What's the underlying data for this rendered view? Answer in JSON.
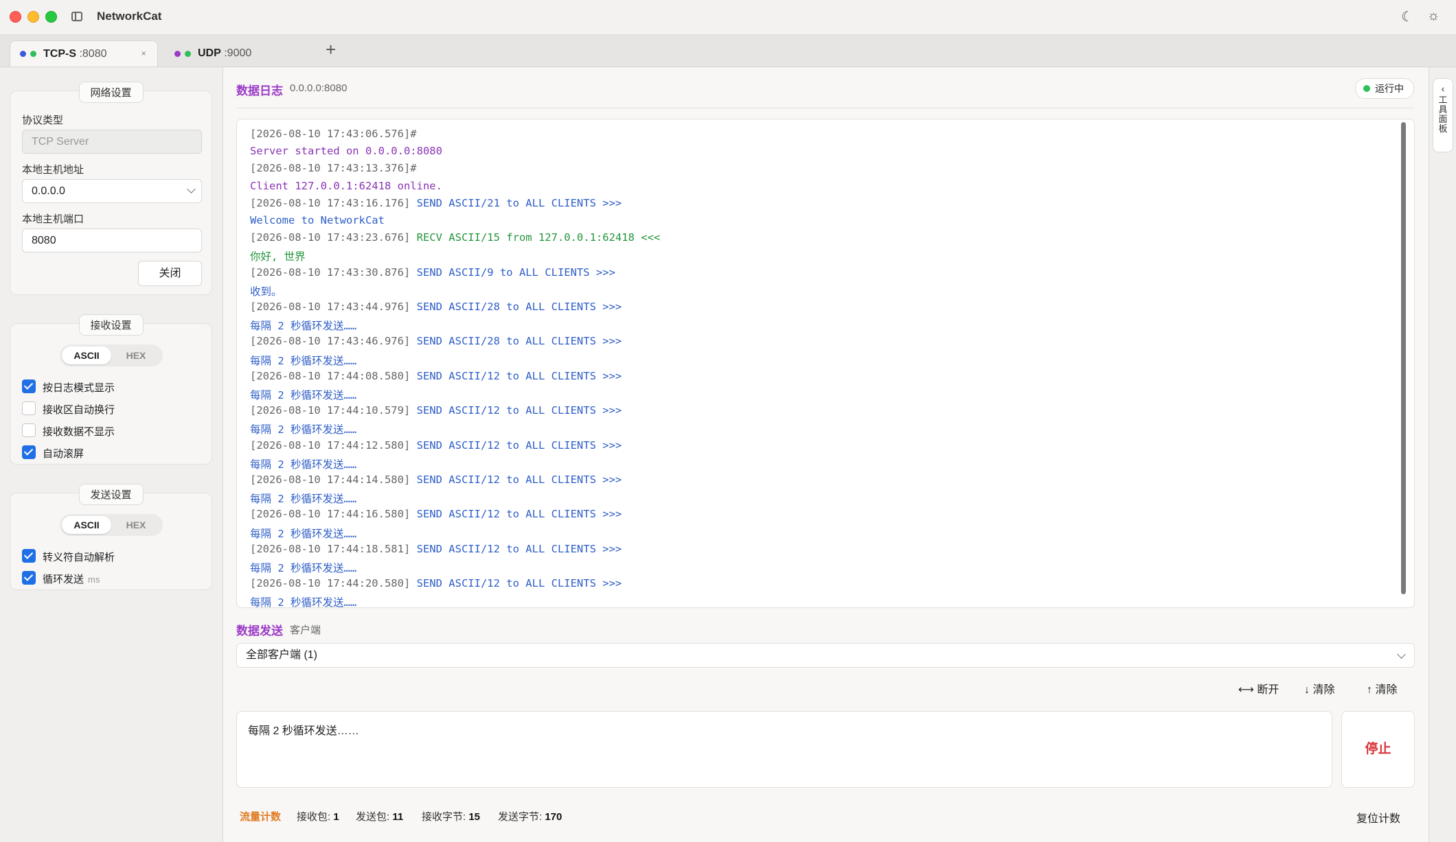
{
  "window": {
    "title": "NetworkCat",
    "theme_icon": "moon-icon",
    "settings_icon": "sun-icon"
  },
  "tabs": [
    {
      "name": "TCP-S",
      "port": ":8080",
      "close": "×",
      "dot_colors": [
        "#3b5bdb",
        "#2ec05a"
      ]
    },
    {
      "name": "UDP",
      "port": ":9000",
      "dot_colors": [
        "#9b3bc6",
        "#2ec05a"
      ]
    }
  ],
  "tab_add": "+",
  "network": {
    "title": "网络设置",
    "protocol_label": "协议类型",
    "protocol_value": "TCP Server",
    "host_label": "本地主机地址",
    "host_value": "0.0.0.0",
    "port_label": "本地主机端口",
    "port_value": "8080",
    "close_button": "关闭"
  },
  "receive": {
    "title": "接收设置",
    "modes": [
      "ASCII",
      "HEX"
    ],
    "selected_mode": "ASCII",
    "options": [
      {
        "label": "按日志模式显示",
        "checked": true
      },
      {
        "label": "接收区自动换行",
        "checked": false
      },
      {
        "label": "接收数据不显示",
        "checked": false
      },
      {
        "label": "自动滚屏",
        "checked": true
      }
    ]
  },
  "send_settings": {
    "title": "发送设置",
    "modes": [
      "ASCII",
      "HEX"
    ],
    "selected_mode": "ASCII",
    "options": [
      {
        "label": "转义符自动解析",
        "checked": true
      },
      {
        "label": "循环发送",
        "checked": true,
        "unit": "ms"
      }
    ]
  },
  "log": {
    "title": "数据日志",
    "address": "0.0.0.0:8080",
    "status": "运行中",
    "lines": [
      {
        "ts": "[2026-08-10 17:43:06.576]#",
        "head": "",
        "type": "sys",
        "body": "Server started on 0.0.0.0:8080"
      },
      {
        "ts": "[2026-08-10 17:43:13.376]#",
        "head": "",
        "type": "sys",
        "body": "Client 127.0.0.1:62418 online."
      },
      {
        "ts": "[2026-08-10 17:43:16.176]",
        "head": "SEND ASCII/21 to ALL CLIENTS >>>",
        "type": "send",
        "body": "Welcome to NetworkCat"
      },
      {
        "ts": "[2026-08-10 17:43:23.676]",
        "head": "RECV ASCII/15 from 127.0.0.1:62418 <<<",
        "type": "recv",
        "body": "你好, 世界"
      },
      {
        "ts": "[2026-08-10 17:43:30.876]",
        "head": "SEND ASCII/9 to ALL CLIENTS >>>",
        "type": "send",
        "body": "收到。"
      },
      {
        "ts": "[2026-08-10 17:43:44.976]",
        "head": "SEND ASCII/28 to ALL CLIENTS >>>",
        "type": "send",
        "body": "每隔 2 秒循环发送……"
      },
      {
        "ts": "[2026-08-10 17:43:46.976]",
        "head": "SEND ASCII/28 to ALL CLIENTS >>>",
        "type": "send",
        "body": "每隔 2 秒循环发送……"
      },
      {
        "ts": "[2026-08-10 17:44:08.580]",
        "head": "SEND ASCII/12 to ALL CLIENTS >>>",
        "type": "send",
        "body": "每隔 2 秒循环发送……"
      },
      {
        "ts": "[2026-08-10 17:44:10.579]",
        "head": "SEND ASCII/12 to ALL CLIENTS >>>",
        "type": "send",
        "body": "每隔 2 秒循环发送……"
      },
      {
        "ts": "[2026-08-10 17:44:12.580]",
        "head": "SEND ASCII/12 to ALL CLIENTS >>>",
        "type": "send",
        "body": "每隔 2 秒循环发送……"
      },
      {
        "ts": "[2026-08-10 17:44:14.580]",
        "head": "SEND ASCII/12 to ALL CLIENTS >>>",
        "type": "send",
        "body": "每隔 2 秒循环发送……"
      },
      {
        "ts": "[2026-08-10 17:44:16.580]",
        "head": "SEND ASCII/12 to ALL CLIENTS >>>",
        "type": "send",
        "body": "每隔 2 秒循环发送……"
      },
      {
        "ts": "[2026-08-10 17:44:18.581]",
        "head": "SEND ASCII/12 to ALL CLIENTS >>>",
        "type": "send",
        "body": "每隔 2 秒循环发送……"
      },
      {
        "ts": "[2026-08-10 17:44:20.580]",
        "head": "SEND ASCII/12 to ALL CLIENTS >>>",
        "type": "send",
        "body": "每隔 2 秒循环发送……"
      }
    ]
  },
  "send": {
    "title": "数据发送",
    "target_label": "客户端",
    "target_value": "全部客户端 (1)",
    "actions": [
      {
        "icon": "disconnect-icon",
        "glyph": "⟷",
        "label": "断开"
      },
      {
        "icon": "arrow-down-icon",
        "glyph": "↓",
        "label": "清除"
      },
      {
        "icon": "arrow-up-icon",
        "glyph": "↑",
        "label": "清除"
      }
    ],
    "input_value": "每隔 2 秒循环发送……",
    "stop_button": "停止"
  },
  "stats": {
    "title": "流量计数",
    "items": [
      {
        "label": "接收包:",
        "value": "1"
      },
      {
        "label": "发送包:",
        "value": "11"
      },
      {
        "label": "接收字节:",
        "value": "15"
      },
      {
        "label": "发送字节:",
        "value": "170"
      }
    ],
    "reset_button": "复位计数"
  },
  "tool_panel": {
    "chevron": "‹",
    "label": "工具面板"
  }
}
